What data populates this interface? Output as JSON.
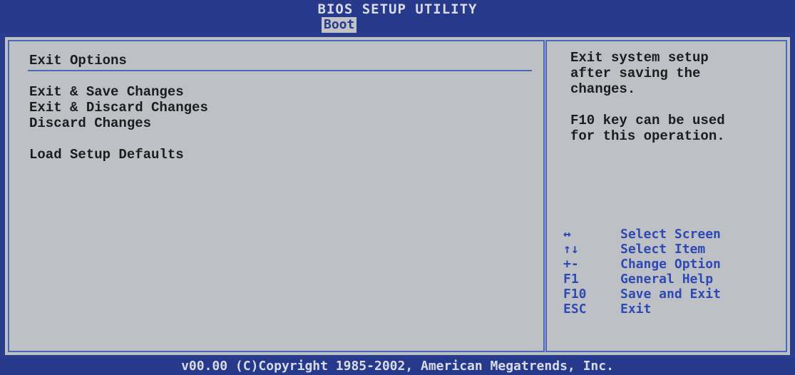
{
  "header": {
    "title": "BIOS SETUP UTILITY",
    "active_tab": "Boot"
  },
  "main": {
    "section_title": "Exit Options",
    "items": [
      {
        "label": "Exit & Save Changes"
      },
      {
        "label": "Exit & Discard Changes"
      },
      {
        "label": "Discard Changes"
      },
      {
        "label": "Load Setup Defaults"
      }
    ]
  },
  "help": {
    "line1": "Exit system setup",
    "line2": "after saving the",
    "line3": "changes.",
    "line4": "F10 key can be used",
    "line5": "for this operation."
  },
  "keys": [
    {
      "key": "↔",
      "desc": "Select Screen"
    },
    {
      "key": "↑↓",
      "desc": "Select Item"
    },
    {
      "key": "+-",
      "desc": "Change Option"
    },
    {
      "key": "F1",
      "desc": "General Help"
    },
    {
      "key": "F10",
      "desc": "Save and Exit"
    },
    {
      "key": "ESC",
      "desc": "Exit"
    }
  ],
  "footer": {
    "copyright": "v00.00 (C)Copyright 1985-2002, American Megatrends, Inc."
  },
  "colors": {
    "header_bg": "#27398a",
    "panel_bg": "#bdc1c6",
    "frame": "#4a68b8",
    "key_text": "#2f49b4"
  }
}
